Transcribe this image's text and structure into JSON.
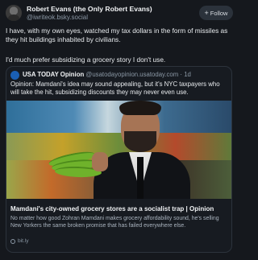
{
  "author": {
    "display_name": "Robert Evans (the Only Robert Evans)",
    "handle": "@iwriteok.bsky.social"
  },
  "follow_button": {
    "icon": "+",
    "label": "Follow"
  },
  "post": {
    "paragraph_1": "I have, with my own eyes, watched my tax dollars in the form of missiles as they hit buildings inhabited by civilians.",
    "paragraph_2": "I'd much prefer subsidizing a grocery story I don't use."
  },
  "quote": {
    "author_name": "USA TODAY Opinion",
    "author_handle": "@usatodayopinion.usatoday.com",
    "separator": " · ",
    "time": "1d",
    "text": "Opinion: Mamdani's idea may sound appealing, but it's NYC taxpayers who will take the hit, subsidizing discounts they may never even use.",
    "link_card": {
      "title": "Mamdani's city-owned grocery stores are a socialist trap | Opinion",
      "description": "No matter how good Zohran Mamdani makes grocery affordability sound, he's selling New Yorkers the same broken promise that has failed everywhere else.",
      "domain": "bit.ly"
    }
  },
  "colors": {
    "background": "#15181d",
    "text": "#f1f3f5",
    "muted": "#8b98a5",
    "card_border": "#2c333c",
    "follow_bg": "#2b323b"
  }
}
